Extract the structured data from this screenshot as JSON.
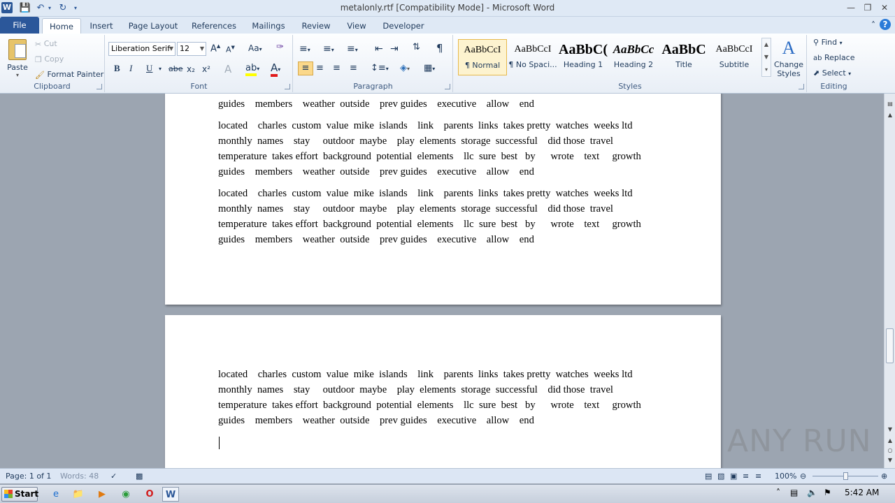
{
  "window": {
    "title": "metalonly.rtf [Compatibility Mode] - Microsoft Word"
  },
  "tabs": [
    "File",
    "Home",
    "Insert",
    "Page Layout",
    "References",
    "Mailings",
    "Review",
    "View",
    "Developer"
  ],
  "clipboard": {
    "paste": "Paste",
    "cut": "Cut",
    "copy": "Copy",
    "format_painter": "Format Painter",
    "label": "Clipboard"
  },
  "font": {
    "family": "Liberation Serif",
    "size": "12",
    "label": "Font",
    "bold": "B",
    "italic": "I",
    "underline": "U",
    "strike": "abe",
    "sub": "x₂",
    "sup": "x²"
  },
  "paragraph": {
    "label": "Paragraph",
    "pilcrow": "¶"
  },
  "styles": {
    "label": "Styles",
    "items": [
      {
        "preview": "AaBbCcI",
        "name": "¶ Normal"
      },
      {
        "preview": "AaBbCcI",
        "name": "¶ No Spaci..."
      },
      {
        "preview": "AaBbC(",
        "name": "Heading 1"
      },
      {
        "preview": "AaBbCc",
        "name": "Heading 2"
      },
      {
        "preview": "AaBbC",
        "name": "Title"
      },
      {
        "preview": "AaBbCcI",
        "name": "Subtitle"
      }
    ],
    "change_styles": "Change Styles"
  },
  "editing": {
    "label": "Editing",
    "find": "Find",
    "replace": "Replace",
    "select": "Select"
  },
  "document": {
    "partial_line": "guides    members    weather  outside    prev guides    executive    allow    end",
    "paragraph_lines": [
      "located    charles  custom  value  mike  islands    link    parents  links  takes pretty  watches  weeks ltd",
      "monthly  names    stay     outdoor  maybe    play  elements  storage  successful    did those  travel",
      "temperature  takes effort  background  potential  elements    llc  sure  best   by      wrote    text     growth",
      "guides    members    weather  outside    prev guides    executive    allow    end"
    ]
  },
  "status": {
    "page": "Page: 1 of 1",
    "words": "Words: 48",
    "zoom": "100%"
  },
  "taskbar": {
    "start": "Start",
    "time": "5:42 AM"
  },
  "watermark": "ANY RUN"
}
